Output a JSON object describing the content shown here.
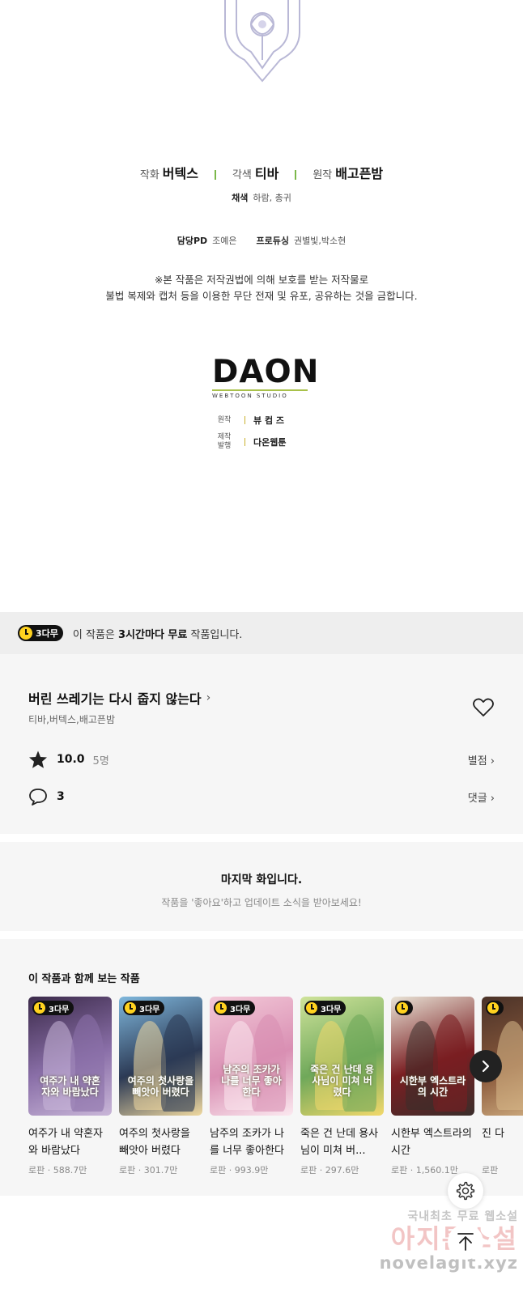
{
  "credits": {
    "art_role": "작화",
    "art_name": "버텍스",
    "story_role": "각색",
    "story_name": "티바",
    "original_role": "원작",
    "original_name": "배고픈밤",
    "color_role": "채색",
    "color_names": "하람, 총귀",
    "pd_role": "담당PD",
    "pd_name": "조예은",
    "producing_role": "프로듀싱",
    "producing_names": "권별빛,박소현",
    "copyright_line1": "※본 작품은 저작권법에 의해 보호를 받는 저작물로",
    "copyright_line2": "불법 복제와 캡처 등을 이용한 무단 전재 및 유포, 공유하는 것을 금합니다."
  },
  "studio": {
    "logo_word": "DAON",
    "logo_sub": "WEBTOON STUDIO",
    "original_role": "원작",
    "original_name": "뷰 컴 즈",
    "produce_role_line1": "제작",
    "produce_role_line2": "발행",
    "produce_name": "다온웹툰"
  },
  "free_banner": {
    "badge": "3다무",
    "text_prefix": "이 작품은 ",
    "text_bold": "3시간마다 무료",
    "text_suffix": " 작품입니다."
  },
  "work": {
    "title": "버린 쓰레기는 다시 줍지 않는다",
    "authors": "티바,버텍스,배고픈밤",
    "rating": "10.0",
    "rating_count": "5명",
    "rating_link": "별점",
    "comments": "3",
    "comment_link": "댓글",
    "heart_icon": "heart-outline-icon"
  },
  "last_episode": {
    "title": "마지막 화입니다.",
    "subtitle": "작품을 '좋아요'하고 업데이트 소식을 받아보세요!"
  },
  "recommendations": {
    "title": "이 작품과 함께 보는 작품",
    "items": [
      {
        "badge": "3다무",
        "cover_text": "여주가 내 약혼자와 바람났다",
        "name": "여주가 내 약혼자와 바람났다",
        "genre": "로판",
        "views": "588.7만",
        "colors": [
          "#3b2a4a",
          "#8a6fa8",
          "#c9b6d8"
        ]
      },
      {
        "badge": "3다무",
        "cover_text": "여주의 첫사랑을 빼앗아 버렸다",
        "name": "여주의 첫사랑을 빼앗아 버렸다",
        "genre": "로판",
        "views": "301.7만",
        "colors": [
          "#7fb7dc",
          "#2c3a55",
          "#f0d9a0"
        ]
      },
      {
        "badge": "3다무",
        "cover_text": "남주의 조카가 나를 너무 좋아한다",
        "name": "남주의 조카가 나를 너무 좋아한다",
        "genre": "로판",
        "views": "993.9만",
        "colors": [
          "#f3c9d8",
          "#d98fb3",
          "#fbe8ef"
        ]
      },
      {
        "badge": "3다무",
        "cover_text": "죽은 건 난데 용사님이 미쳐 버렸다",
        "name": "죽은 건 난데 용사님이 미쳐 버...",
        "genre": "로판",
        "views": "297.6만",
        "colors": [
          "#cfe39a",
          "#6fa85a",
          "#f2d86b"
        ]
      },
      {
        "badge": "",
        "cover_text": "시한부 엑스트라의 시간",
        "name": "시한부 엑스트라의 시간",
        "genre": "로판",
        "views": "1,560.1만",
        "colors": [
          "#e9e3d6",
          "#7a1e22",
          "#3a2d2a"
        ]
      },
      {
        "badge": "",
        "cover_text": "",
        "name": "진 다",
        "genre": "로판",
        "views": "",
        "colors": [
          "#4a3228",
          "#8b5a3c",
          "#d9b98a"
        ]
      }
    ]
  },
  "controls": {
    "next_icon": "chevron-right-icon",
    "settings_icon": "gear-icon",
    "top_icon": "arrow-up-icon"
  },
  "watermark": {
    "line1": "국내최초 무료 웹소설",
    "line2": "아지툰소설",
    "line3": "novelagit.xyz"
  }
}
